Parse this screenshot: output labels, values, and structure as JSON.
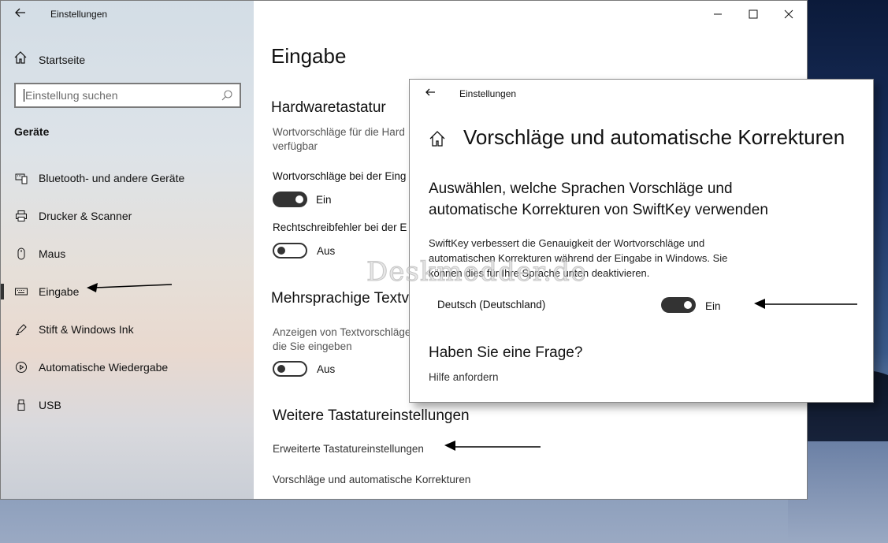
{
  "app": {
    "title": "Einstellungen",
    "window_controls": {
      "minimize": "—",
      "maximize": "☐",
      "close": "✕"
    }
  },
  "sidebar": {
    "home_label": "Startseite",
    "search_placeholder": "Einstellung suchen",
    "section_title": "Geräte",
    "items": [
      {
        "label": "Bluetooth- und andere Geräte",
        "icon": "bluetooth-devices-icon"
      },
      {
        "label": "Drucker & Scanner",
        "icon": "printer-icon"
      },
      {
        "label": "Maus",
        "icon": "mouse-icon"
      },
      {
        "label": "Eingabe",
        "icon": "keyboard-icon",
        "active": true
      },
      {
        "label": "Stift & Windows Ink",
        "icon": "pen-icon"
      },
      {
        "label": "Automatische Wiedergabe",
        "icon": "autoplay-icon"
      },
      {
        "label": "USB",
        "icon": "usb-icon"
      }
    ]
  },
  "main": {
    "title": "Eingabe",
    "hardware": {
      "heading": "Hardwaretastatur",
      "desc_line1": "Wortvorschläge für die Hard",
      "desc_line2": "verfügbar",
      "setting1_label": "Wortvorschläge bei der Eing",
      "setting1_state": "Ein",
      "setting2_label": "Rechtschreibfehler bei der E",
      "setting2_state": "Aus"
    },
    "multilingual": {
      "heading": "Mehrsprachige Textv",
      "desc_line1": "Anzeigen von Textvorschläge",
      "desc_line2": "die Sie eingeben",
      "state": "Aus"
    },
    "more": {
      "heading": "Weitere Tastatureinstellungen",
      "link1": "Erweiterte Tastatureinstellungen",
      "link2": "Vorschläge und automatische Korrekturen"
    }
  },
  "overlay": {
    "titlebar": "Einstellungen",
    "title": "Vorschläge und automatische Korrekturen",
    "heading_line1": "Auswählen, welche Sprachen Vorschläge und",
    "heading_line2": "automatische Korrekturen von SwiftKey verwenden",
    "desc_line1": "SwiftKey verbessert die Genauigkeit der Wortvorschläge und",
    "desc_line2": "automatischen Korrekturen während der Eingabe in Windows. Sie",
    "desc_line3": "können dies für Ihre Sprache unten deaktivieren.",
    "language": "Deutsch (Deutschland)",
    "language_state": "Ein",
    "question": "Haben Sie eine Frage?",
    "help_link": "Hilfe anfordern"
  },
  "watermark": "Deskmodder.de",
  "toggles": {
    "hardware_word_suggestions": true,
    "hardware_autocorrect": false,
    "multilingual_suggestions": false,
    "swiftkey_deutsch": true
  }
}
